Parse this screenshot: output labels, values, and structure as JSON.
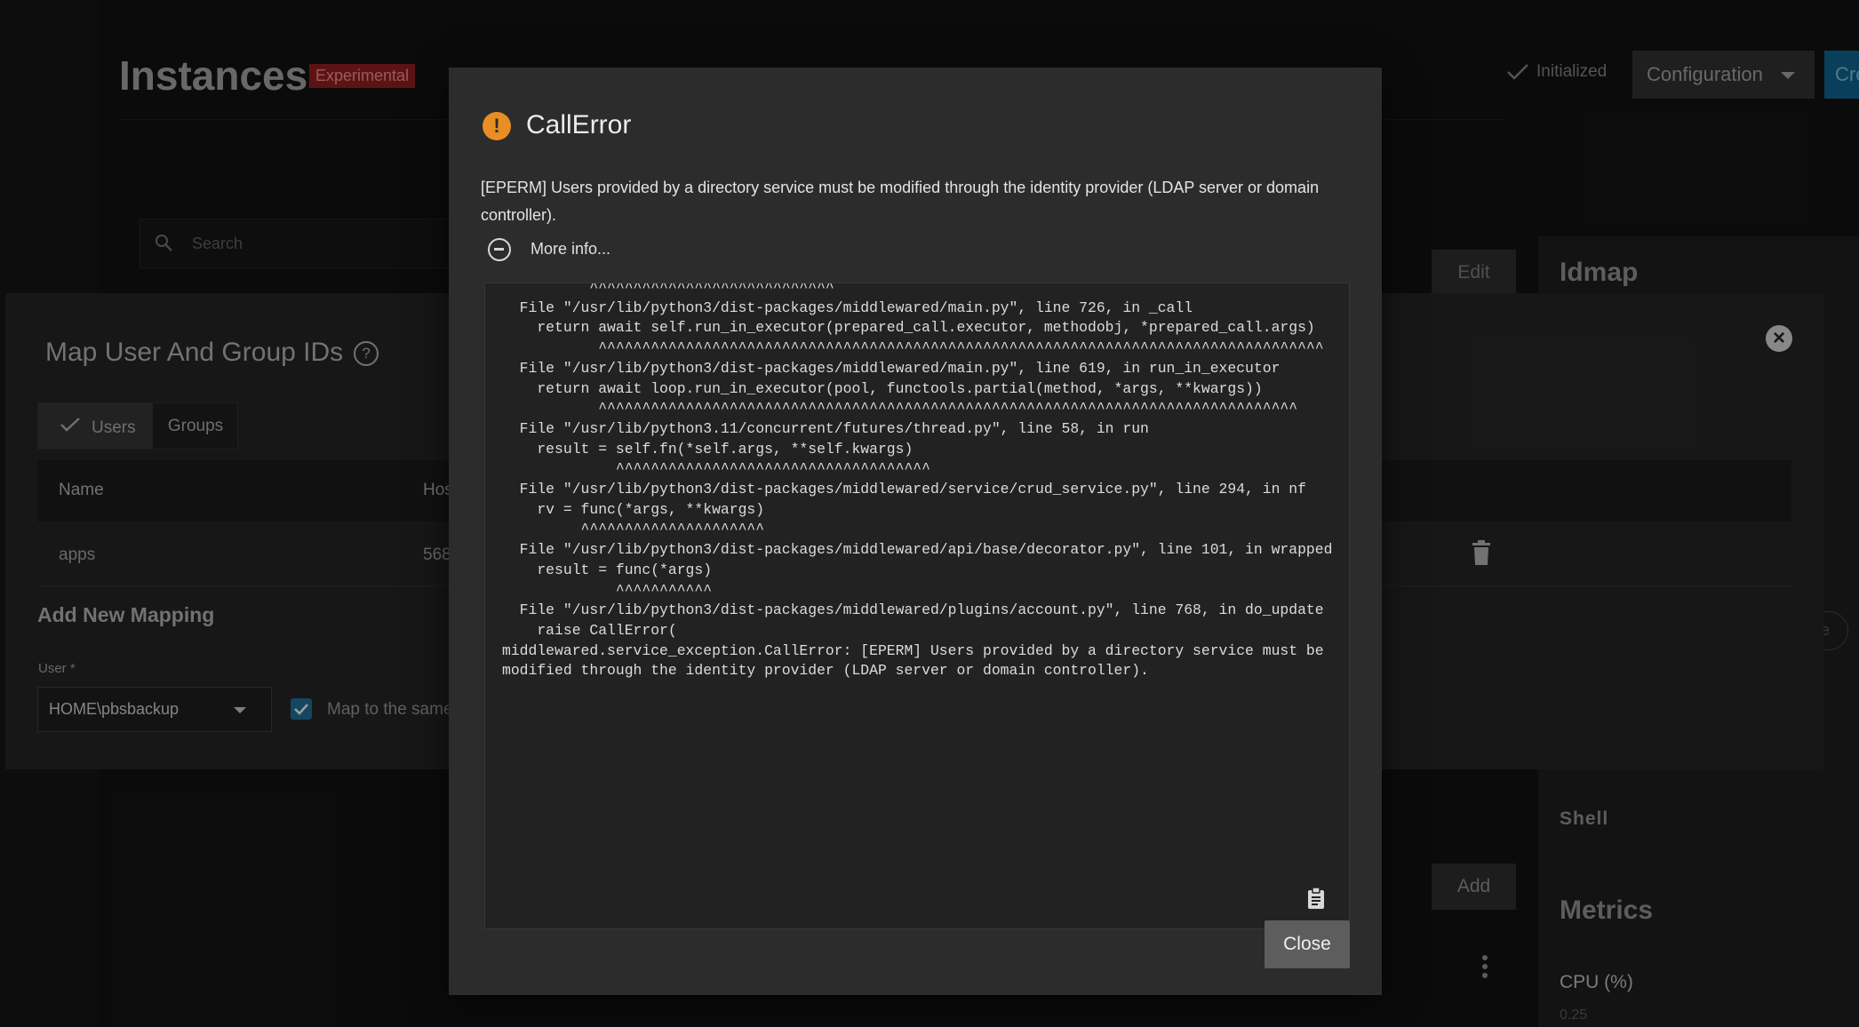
{
  "page": {
    "title": "Instances",
    "badge": "Experimental",
    "status": "Initialized",
    "configuration_label": "Configuration",
    "create_label": "Cre",
    "search_placeholder": "Search",
    "edit_label": "Edit",
    "add_label": "Add",
    "idmap_title": "Idmap",
    "shell_label": "Shell",
    "metrics_title": "Metrics",
    "cpu_label": "CPU (%)",
    "cpu_value": "0.25",
    "circle_btn_label": "e"
  },
  "sheet": {
    "title": "Map User And Group IDs",
    "tabs": {
      "users": "Users",
      "groups": "Groups"
    },
    "columns": {
      "name": "Name",
      "host": "Hos"
    },
    "rows": [
      {
        "name": "apps",
        "host": "568"
      }
    ],
    "add_mapping_title": "Add New Mapping",
    "user_label": "User *",
    "user_value": "HOME\\pbsbackup",
    "map_same_label": "Map to the same"
  },
  "dialog": {
    "title": "CallError",
    "message": "[EPERM] Users provided by a directory service must be modified through the identity provider (LDAP server or domain controller).",
    "more_info": "More info...",
    "trace": "          ^^^^^^^^^^^^^^^^^^^^^^^^^^^^\n  File \"/usr/lib/python3/dist-packages/middlewared/main.py\", line 726, in _call\n    return await self.run_in_executor(prepared_call.executor, methodobj, *prepared_call.args)\n           ^^^^^^^^^^^^^^^^^^^^^^^^^^^^^^^^^^^^^^^^^^^^^^^^^^^^^^^^^^^^^^^^^^^^^^^^^^^^^^^^^^^\n  File \"/usr/lib/python3/dist-packages/middlewared/main.py\", line 619, in run_in_executor\n    return await loop.run_in_executor(pool, functools.partial(method, *args, **kwargs))\n           ^^^^^^^^^^^^^^^^^^^^^^^^^^^^^^^^^^^^^^^^^^^^^^^^^^^^^^^^^^^^^^^^^^^^^^^^^^^^^^^^\n  File \"/usr/lib/python3.11/concurrent/futures/thread.py\", line 58, in run\n    result = self.fn(*self.args, **self.kwargs)\n             ^^^^^^^^^^^^^^^^^^^^^^^^^^^^^^^^^^^^\n  File \"/usr/lib/python3/dist-packages/middlewared/service/crud_service.py\", line 294, in nf\n    rv = func(*args, **kwargs)\n         ^^^^^^^^^^^^^^^^^^^^^\n  File \"/usr/lib/python3/dist-packages/middlewared/api/base/decorator.py\", line 101, in wrapped\n    result = func(*args)\n             ^^^^^^^^^^^\n  File \"/usr/lib/python3/dist-packages/middlewared/plugins/account.py\", line 768, in do_update\n    raise CallError(\nmiddlewared.service_exception.CallError: [EPERM] Users provided by a directory service must be\nmodified through the identity provider (LDAP server or domain controller).",
    "close_label": "Close"
  }
}
